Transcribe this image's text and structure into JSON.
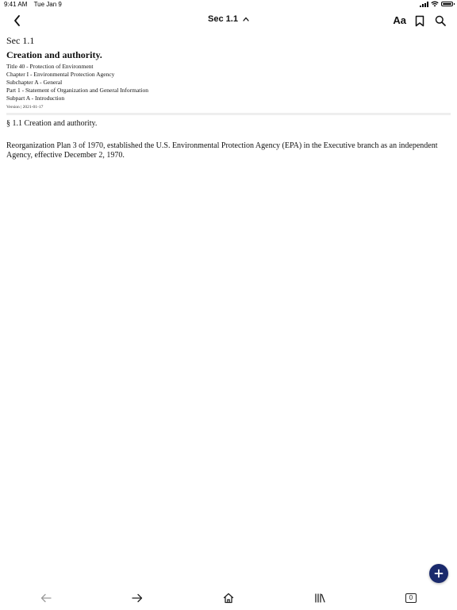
{
  "status_bar": {
    "time": "9:41 AM",
    "date": "Tue Jan 9",
    "battery_level": 1.0
  },
  "nav": {
    "title": "Sec 1.1",
    "font_button_label": "Aa",
    "icons": {
      "back": "chevron-left-icon",
      "title_toggle": "chevron-up-icon",
      "bookmark": "bookmark-icon",
      "search": "search-icon"
    }
  },
  "document": {
    "section_label": "Sec 1.1",
    "title": "Creation and authority.",
    "hierarchy": [
      "Title 40 - Protection of Environment",
      "Chapter I - Environmental Protection Agency",
      "Subchapter A - General",
      "Part 1 - Statement of Organization and General Information",
      "Subpart A - Introduction"
    ],
    "version": "Version | 2021-01-17",
    "section_heading": "§ 1.1 Creation and authority.",
    "paragraph": "Reorganization Plan 3 of 1970, established the U.S. Environmental Protection Agency (EPA) in the Executive branch as an independent Agency, effective December 2, 1970."
  },
  "fab": {
    "icon": "plus-icon",
    "color": "#1a2a6c"
  },
  "toolbar": {
    "icons": [
      "arrow-left-icon",
      "arrow-right-icon",
      "home-icon",
      "library-icon",
      "tabs-icon"
    ],
    "tab_count": "0"
  }
}
